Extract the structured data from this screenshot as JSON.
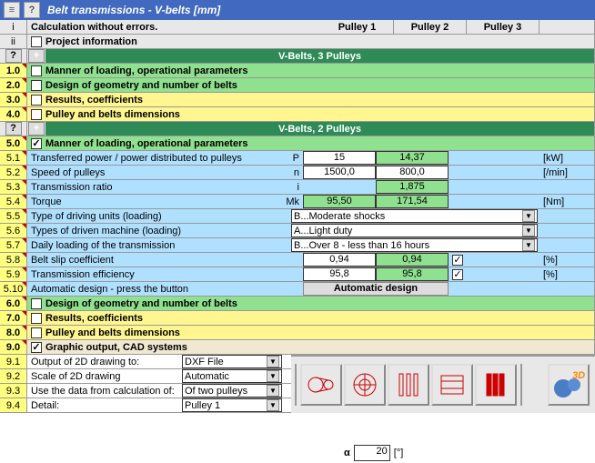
{
  "title": "Belt transmissions - V-belts [mm]",
  "hdr": {
    "i": "i",
    "status": "Calculation without errors.",
    "p1": "Pulley 1",
    "p2": "Pulley 2",
    "p3": "Pulley 3",
    "ii": "ii",
    "proj": "Project information"
  },
  "g3": {
    "q": "?",
    "plus": "+",
    "title": "V-Belts, 3 Pulleys"
  },
  "s1": {
    "n": "1.0",
    "t": "Manner of loading, operational parameters"
  },
  "s2": {
    "n": "2.0",
    "t": "Design of geometry and number of belts"
  },
  "s3": {
    "n": "3.0",
    "t": "Results, coefficients"
  },
  "s4": {
    "n": "4.0",
    "t": "Pulley and belts dimensions"
  },
  "g2": {
    "q": "?",
    "plus": "+",
    "title": "V-Belts, 2 Pulleys"
  },
  "s5": {
    "n": "5.0",
    "t": "Manner of loading, operational parameters"
  },
  "r51": {
    "n": "5.1",
    "t": "Transferred power / power distributed to pulleys",
    "s": "P",
    "v1": "15",
    "v2": "14,37",
    "u": "[kW]"
  },
  "r52": {
    "n": "5.2",
    "t": "Speed of pulleys",
    "s": "n",
    "v1": "1500,0",
    "v2": "800,0",
    "u": "[/min]"
  },
  "r53": {
    "n": "5.3",
    "t": "Transmission ratio",
    "s": "i",
    "v2": "1,875"
  },
  "r54": {
    "n": "5.4",
    "t": "Torque",
    "s": "Mk",
    "v1": "95,50",
    "v2": "171,54",
    "u": "[Nm]"
  },
  "r55": {
    "n": "5.5",
    "t": "Type of driving units (loading)",
    "sel": "B...Moderate shocks"
  },
  "r56": {
    "n": "5.6",
    "t": "Types of driven machine (loading)",
    "sel": "A...Light duty"
  },
  "r57": {
    "n": "5.7",
    "t": "Daily loading of the transmission",
    "sel": "B...Over 8 - less than 16 hours"
  },
  "r58": {
    "n": "5.8",
    "t": "Belt slip coefficient",
    "v1": "0,94",
    "v2": "0,94",
    "u": "[%]"
  },
  "r59": {
    "n": "5.9",
    "t": "Transmission efficiency",
    "v1": "95,8",
    "v2": "95,8",
    "u": "[%]"
  },
  "r510": {
    "n": "5.10",
    "t": "Automatic design - press the button",
    "btn": "Automatic design"
  },
  "s6": {
    "n": "6.0",
    "t": "Design of geometry and number of belts"
  },
  "s7": {
    "n": "7.0",
    "t": "Results, coefficients"
  },
  "s8": {
    "n": "8.0",
    "t": "Pulley and belts dimensions"
  },
  "s9": {
    "n": "9.0",
    "t": "Graphic output, CAD systems"
  },
  "r91": {
    "n": "9.1",
    "t": "Output of 2D drawing to:",
    "sel": "DXF File"
  },
  "r92": {
    "n": "9.2",
    "t": "Scale of 2D drawing",
    "sel": "Automatic"
  },
  "r93": {
    "n": "9.3",
    "t": "Use the data from calculation of:",
    "sel": "Of two pulleys"
  },
  "r94": {
    "n": "9.4",
    "t": "Detail:",
    "sel": "Pulley 1"
  },
  "alpha": {
    "sym": "α",
    "val": "20",
    "u": "[°]"
  },
  "chk": "✓"
}
